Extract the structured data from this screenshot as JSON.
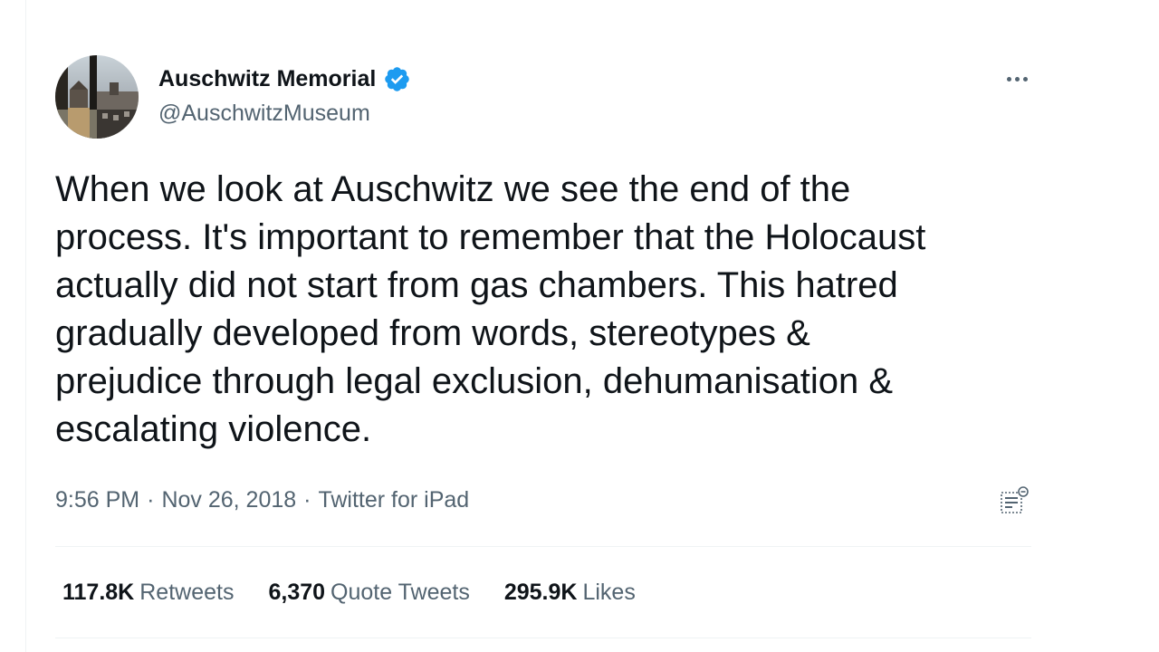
{
  "author": {
    "display_name": "Auschwitz Memorial",
    "handle": "@AuschwitzMuseum",
    "verified": true,
    "verified_color": "#1d9bf0"
  },
  "tweet": {
    "text": "When we look at Auschwitz we see the end of the\nprocess. It's important to remember that the Holocaust\nactually did not start from gas chambers. This hatred\ngradually developed from words, stereotypes &\nprejudice through legal exclusion, dehumanisation &\nescalating violence.",
    "time": "9:56 PM",
    "date": "Nov 26, 2018",
    "separator": "·",
    "source": "Twitter for iPad"
  },
  "stats": {
    "retweets_count": "117.8K",
    "retweets_label": "Retweets",
    "quotes_count": "6,370",
    "quotes_label": "Quote Tweets",
    "likes_count": "295.9K",
    "likes_label": "Likes"
  },
  "icons": {
    "more": "more-horizontal-icon",
    "analytics": "analytics-icon",
    "verified": "verified-badge-icon"
  },
  "colors": {
    "text_primary": "#0f1419",
    "text_secondary": "#536471",
    "divider": "#eff3f4"
  }
}
